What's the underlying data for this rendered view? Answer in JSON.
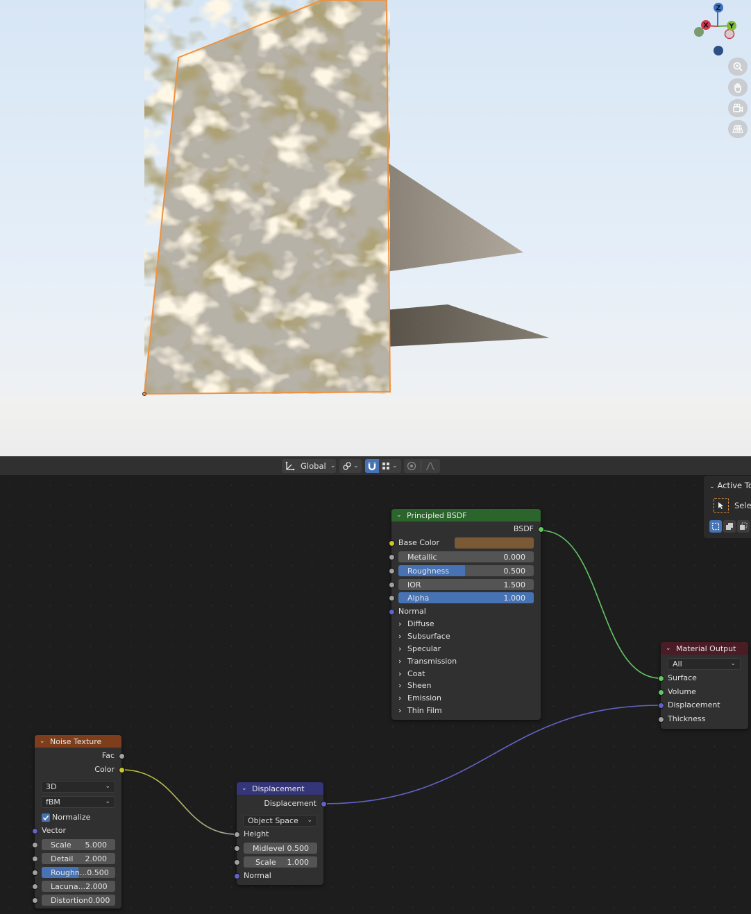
{
  "toolbar": {
    "orientation_label": "Global"
  },
  "gizmo": {
    "x": "X",
    "y": "Y",
    "z": "Z"
  },
  "tool_panel": {
    "title": "Active To",
    "select_label": "Sele"
  },
  "nodes": {
    "principled": {
      "title": "Principled BSDF",
      "output": "BSDF",
      "base_color_label": "Base Color",
      "base_color_swatch": "#7a5a35",
      "metallic": {
        "label": "Metallic",
        "value": "0.000"
      },
      "roughness": {
        "label": "Roughness",
        "value": "0.500",
        "fill": 0.5
      },
      "ior": {
        "label": "IOR",
        "value": "1.500"
      },
      "alpha": {
        "label": "Alpha",
        "value": "1.000",
        "fill": 1.0
      },
      "normal_label": "Normal",
      "panels": [
        "Diffuse",
        "Subsurface",
        "Specular",
        "Transmission",
        "Coat",
        "Sheen",
        "Emission",
        "Thin Film"
      ]
    },
    "output": {
      "title": "Material Output",
      "target": "All",
      "inputs": [
        "Surface",
        "Volume",
        "Displacement",
        "Thickness"
      ]
    },
    "noise": {
      "title": "Noise Texture",
      "out_fac": "Fac",
      "out_color": "Color",
      "dimensions": "3D",
      "type": "fBM",
      "normalize_label": "Normalize",
      "normalize_checked": true,
      "vector_label": "Vector",
      "scale": {
        "label": "Scale",
        "value": "5.000"
      },
      "detail": {
        "label": "Detail",
        "value": "2.000"
      },
      "roughness": {
        "label": "Roughn...",
        "value": "0.500",
        "fill": 0.5
      },
      "lacunarity": {
        "label": "Lacuna...",
        "value": "2.000"
      },
      "distortion": {
        "label": "Distortion",
        "value": "0.000"
      }
    },
    "displacement": {
      "title": "Displacement",
      "output": "Displacement",
      "space": "Object Space",
      "height_label": "Height",
      "midlevel": {
        "label": "Midlevel",
        "value": "0.500"
      },
      "scale": {
        "label": "Scale",
        "value": "1.000"
      },
      "normal_label": "Normal"
    }
  },
  "colors": {
    "principled_header": "#2b652b",
    "output_header": "#4a1c26",
    "noise_header": "#7e3e1b",
    "displacement_header": "#35357a",
    "accent": "#4772b3"
  }
}
